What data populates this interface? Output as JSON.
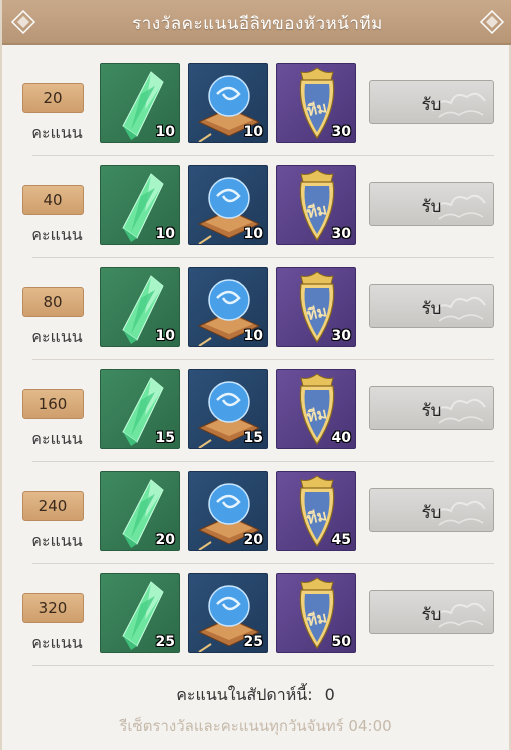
{
  "header": {
    "title": "รางวัลคะแนนอีลิทของหัวหน้าทีม",
    "left_ornament": "ornament-icon",
    "right_ornament": "ornament-icon"
  },
  "score_unit": "คะแนน",
  "claim_label": "รับ",
  "rows": [
    {
      "score": "20",
      "rewards": [
        {
          "icon": "green-crystal-icon",
          "qty": "10"
        },
        {
          "icon": "blue-orb-icon",
          "qty": "10"
        },
        {
          "icon": "team-badge-icon",
          "qty": "30"
        }
      ]
    },
    {
      "score": "40",
      "rewards": [
        {
          "icon": "green-crystal-icon",
          "qty": "10"
        },
        {
          "icon": "blue-orb-icon",
          "qty": "10"
        },
        {
          "icon": "team-badge-icon",
          "qty": "30"
        }
      ]
    },
    {
      "score": "80",
      "rewards": [
        {
          "icon": "green-crystal-icon",
          "qty": "10"
        },
        {
          "icon": "blue-orb-icon",
          "qty": "10"
        },
        {
          "icon": "team-badge-icon",
          "qty": "30"
        }
      ]
    },
    {
      "score": "160",
      "rewards": [
        {
          "icon": "green-crystal-icon",
          "qty": "15"
        },
        {
          "icon": "blue-orb-icon",
          "qty": "15"
        },
        {
          "icon": "team-badge-icon",
          "qty": "40"
        }
      ]
    },
    {
      "score": "240",
      "rewards": [
        {
          "icon": "green-crystal-icon",
          "qty": "20"
        },
        {
          "icon": "blue-orb-icon",
          "qty": "20"
        },
        {
          "icon": "team-badge-icon",
          "qty": "45"
        }
      ]
    },
    {
      "score": "320",
      "rewards": [
        {
          "icon": "green-crystal-icon",
          "qty": "25"
        },
        {
          "icon": "blue-orb-icon",
          "qty": "25"
        },
        {
          "icon": "team-badge-icon",
          "qty": "50"
        }
      ]
    }
  ],
  "footer": {
    "weekly_label": "คะแนนในสัปดาห์นี้:",
    "weekly_value": "0",
    "reset_note": "รีเซ็ตรางวัลและคะแนนทุกวันจันทร์ 04:00"
  },
  "colors": {
    "header_bg": "#b79676",
    "score_box": "#d6a878",
    "button_bg": "#d0cecb",
    "footer_note": "#c5b9a9"
  }
}
